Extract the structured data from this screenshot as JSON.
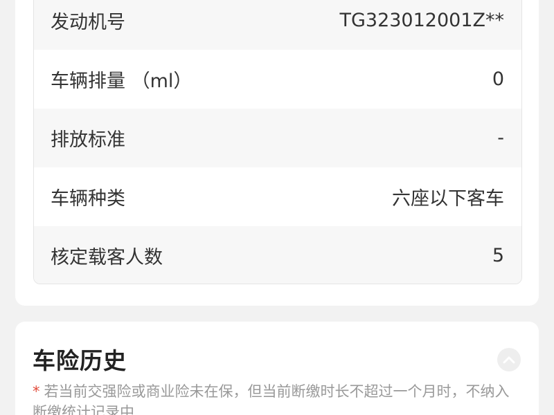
{
  "vehicle_info": {
    "rows": [
      {
        "label": "发动机号",
        "value": "TG323012001Z**"
      },
      {
        "label": "车辆排量 （ml）",
        "value": "0"
      },
      {
        "label": "排放标准",
        "value": "-"
      },
      {
        "label": "车辆种类",
        "value": "六座以下客车"
      },
      {
        "label": "核定载客人数",
        "value": "5"
      }
    ]
  },
  "insurance_history": {
    "title": "车险历史",
    "toggle_icon": "chevron-up-icon",
    "notice_marker": "*",
    "notice_text": "若当前交强险或商业险未在保，但当前断缴时长不超过一个月时，不纳入断缴统计记录中"
  },
  "colors": {
    "page_bg": "#f2f2f2",
    "card_bg": "#ffffff",
    "row_shade": "#f7f7f7",
    "text_primary": "#333333",
    "text_muted": "#999999",
    "accent_red": "#e24b3b"
  }
}
